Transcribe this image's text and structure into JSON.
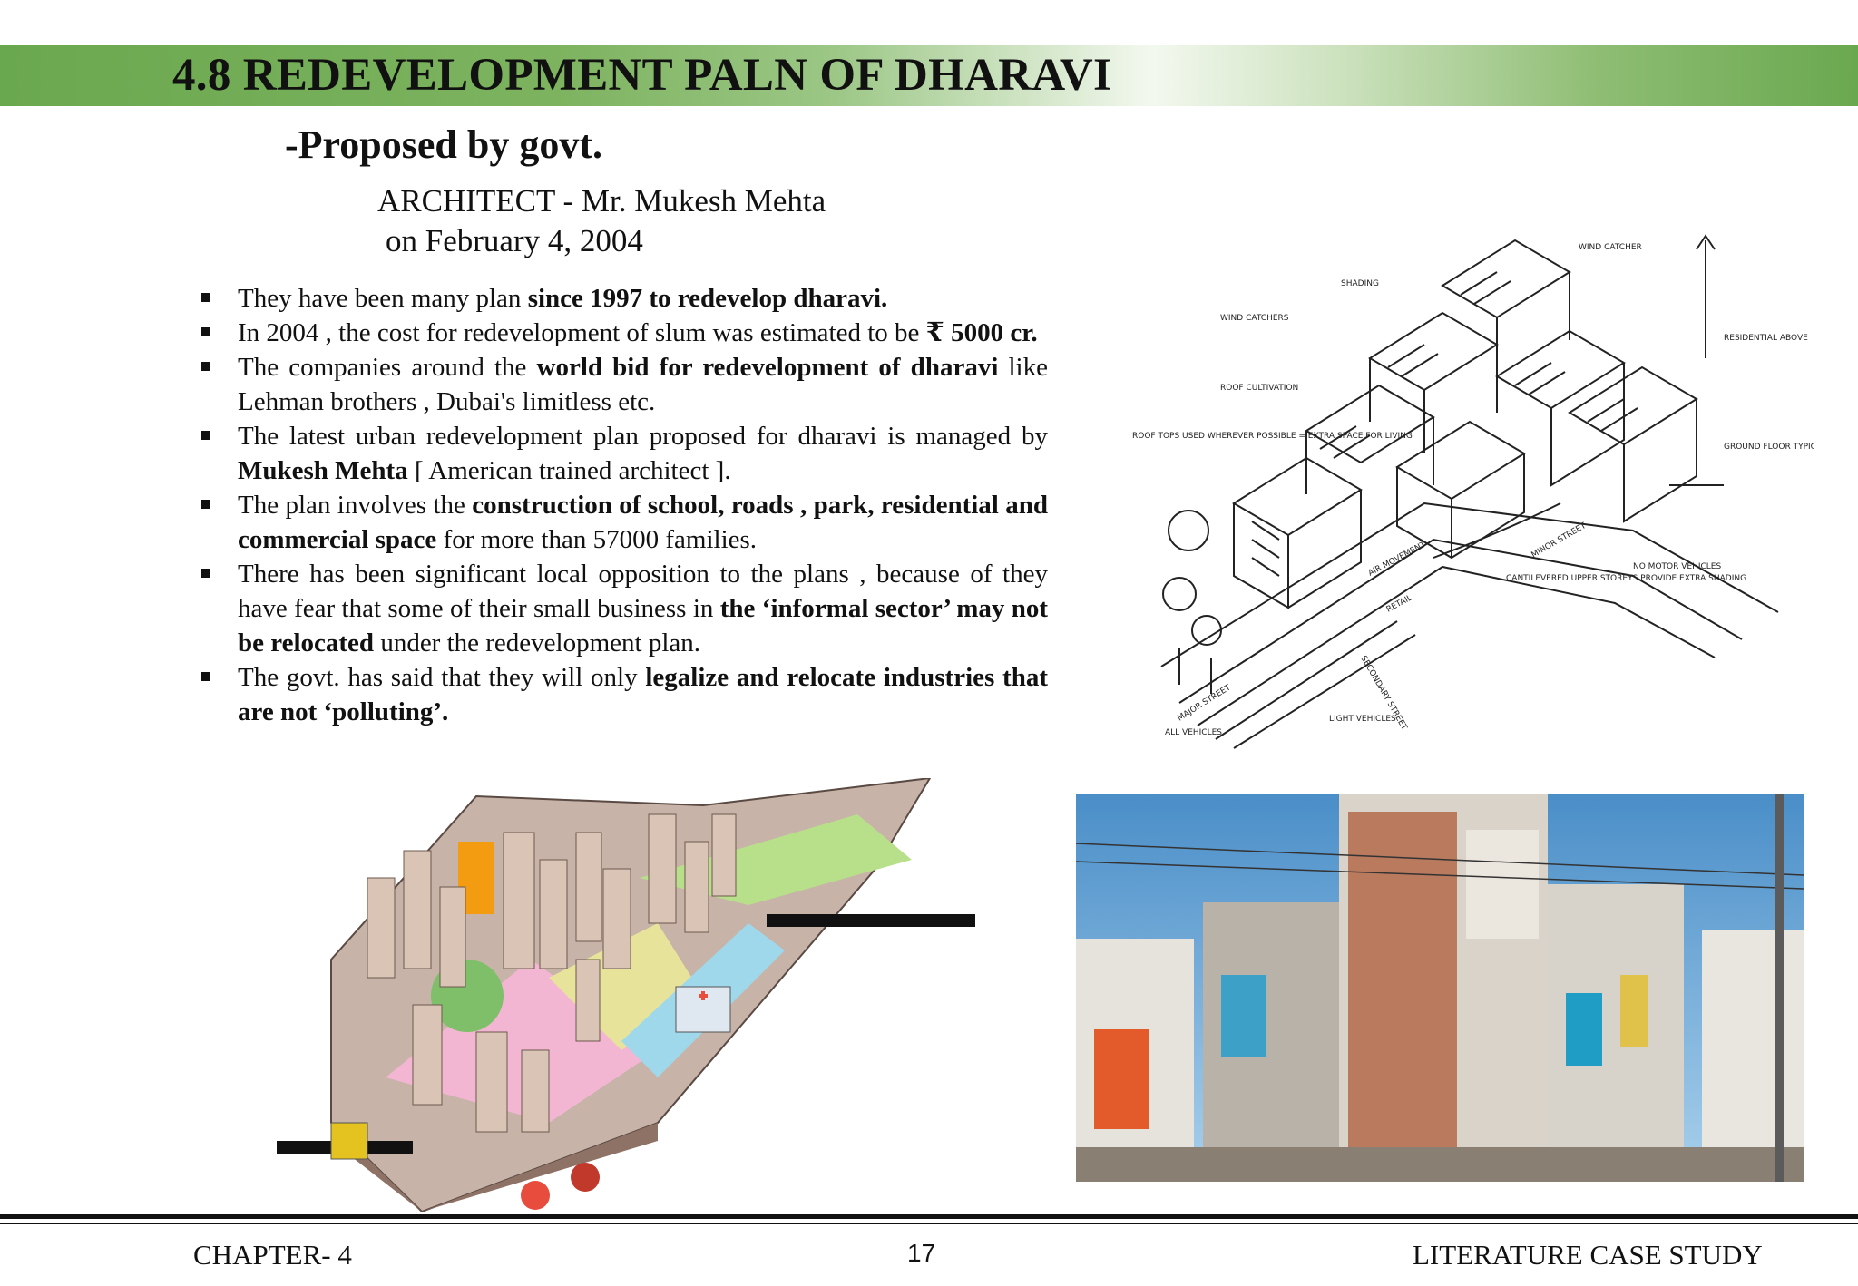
{
  "header": {
    "title": "4.8 REDEVELOPMENT PALN OF DHARAVI",
    "subtitle": "-Proposed by govt.",
    "architect": "ARCHITECT - Mr. Mukesh Mehta",
    "date": " on February 4, 2004"
  },
  "bullets": [
    {
      "parts": [
        {
          "t": "They have been many plan ",
          "b": false
        },
        {
          "t": "since 1997 to redevelop dharavi.",
          "b": true
        }
      ]
    },
    {
      "parts": [
        {
          "t": "In 2004 , the cost for redevelopment of slum was estimated  to be ",
          "b": false
        },
        {
          "t": "₹ 5000 cr.",
          "b": true
        }
      ]
    },
    {
      "parts": [
        {
          "t": "The companies around the ",
          "b": false
        },
        {
          "t": "world bid for redevelopment of dharavi",
          "b": true
        },
        {
          "t": " like Lehman brothers , Dubai's  limitless etc.",
          "b": false
        }
      ]
    },
    {
      "parts": [
        {
          "t": "The latest urban redevelopment plan proposed for dharavi is managed by ",
          "b": false
        },
        {
          "t": "Mukesh Mehta",
          "b": true
        },
        {
          "t": " [ American trained architect ].",
          "b": false
        }
      ]
    },
    {
      "parts": [
        {
          "t": "The plan involves the ",
          "b": false
        },
        {
          "t": "construction  of school, roads , park, residential and commercial space",
          "b": true
        },
        {
          "t": " for more than 57000 families.",
          "b": false
        }
      ]
    },
    {
      "parts": [
        {
          "t": " There has been significant local opposition to the plans , because of they have fear that some of their small business in ",
          "b": false
        },
        {
          "t": "the ‘informal sector’ may not be relocated",
          "b": true
        },
        {
          "t": " under the redevelopment plan.",
          "b": false
        }
      ]
    },
    {
      "parts": [
        {
          "t": "The govt. has said that they will only ",
          "b": false
        },
        {
          "t": "legalize and relocate industries that are not ‘polluting’.",
          "b": true
        }
      ]
    }
  ],
  "sketch_labels": {
    "wind_catcher": "WIND CATCHER",
    "shading": "SHADING",
    "wind_catchers": "WIND CATCHERS",
    "roof_cultivation": "ROOF CULTIVATION",
    "roof_tops": "ROOF TOPS USED WHEREVER POSSIBLE = EXTRA SPACE FOR LIVING",
    "residential_above": "RESIDENTIAL ABOVE",
    "ground_floor": "GROUND FLOOR TYPICALLY COMMERCIAL - LIVE/WORK",
    "air_movement": "AIR MOVEMENT",
    "minor_street": "MINOR STREET",
    "no_motor": "NO MOTOR VEHICLES",
    "cantilevered": "CANTILEVERED UPPER STOREYS PROVIDE EXTRA SHADING",
    "major_street": "MAJOR STREET",
    "all_vehicles": "ALL VEHICLES",
    "light_vehicles": "LIGHT VEHICLES",
    "secondary_street": "SECONDARY STREET",
    "retail": "RETAIL"
  },
  "footer": {
    "left": "CHAPTER- 4",
    "page": "17",
    "right": "LITERATURE CASE STUDY"
  }
}
